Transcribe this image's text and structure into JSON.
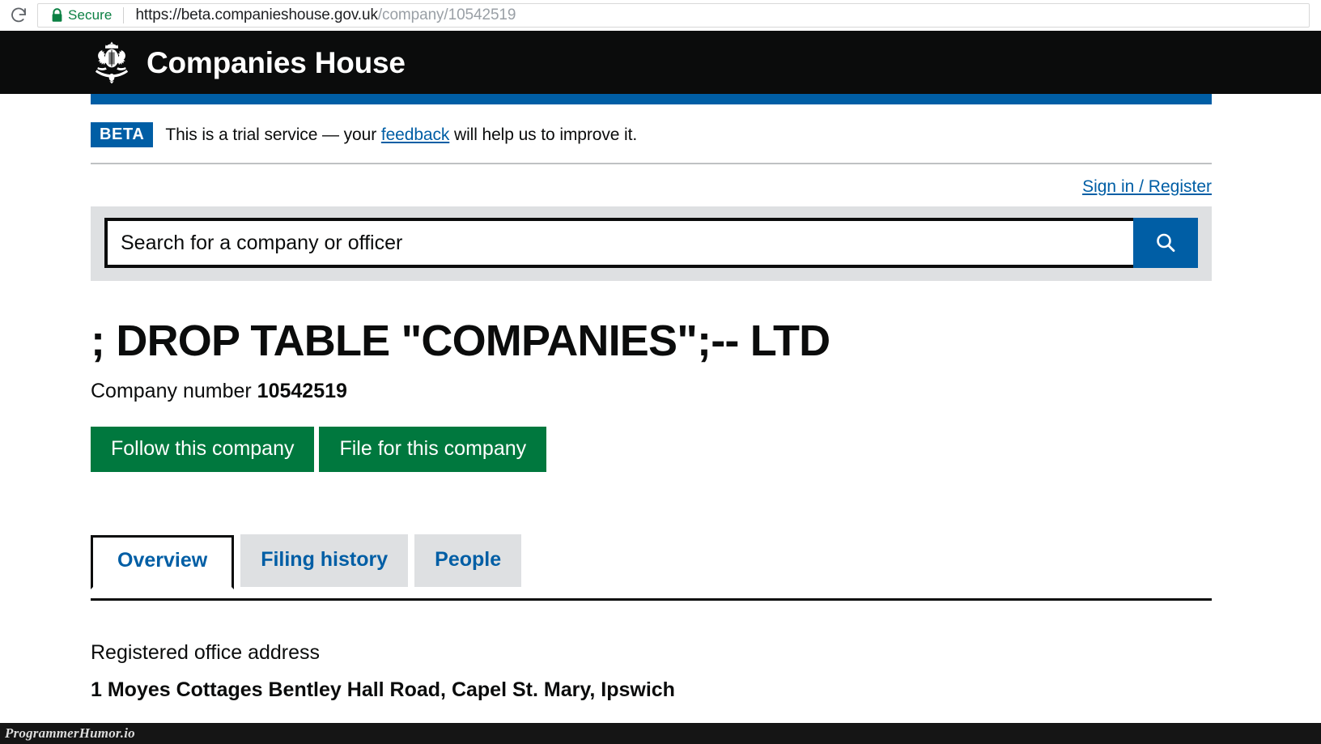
{
  "browser": {
    "reload_icon": "reload-icon",
    "security_icon": "lock-icon",
    "security_label": "Secure",
    "url_domain": "https://beta.companieshouse.gov.uk",
    "url_path": "/company/10542519"
  },
  "header": {
    "crest_icon": "royal-coat-of-arms-icon",
    "brand": "Companies House"
  },
  "beta_banner": {
    "tag": "BETA",
    "text_before": "This is a trial service — your",
    "link": "feedback",
    "text_after": "will help us to improve it."
  },
  "account": {
    "signin_label": "Sign in / Register"
  },
  "search": {
    "placeholder": "Search for a company or officer",
    "value": "",
    "button_icon": "search-icon"
  },
  "company": {
    "name": "; DROP TABLE \"COMPANIES\";-- LTD",
    "number_label": "Company number",
    "number": "10542519"
  },
  "actions": {
    "follow_label": "Follow this company",
    "file_label": "File for this company"
  },
  "tabs": [
    {
      "label": "Overview",
      "active": true
    },
    {
      "label": "Filing history",
      "active": false
    },
    {
      "label": "People",
      "active": false
    }
  ],
  "overview": {
    "address_label": "Registered office address",
    "address_value": "1 Moyes Cottages Bentley Hall Road, Capel St. Mary, Ipswich"
  },
  "watermark": {
    "text": "ProgrammerHumor.io"
  },
  "colors": {
    "brand_black": "#0b0c0c",
    "gov_blue": "#005ea5",
    "gov_green": "#00783e",
    "grey_bg": "#dee0e2",
    "secure_green": "#0b8043"
  }
}
